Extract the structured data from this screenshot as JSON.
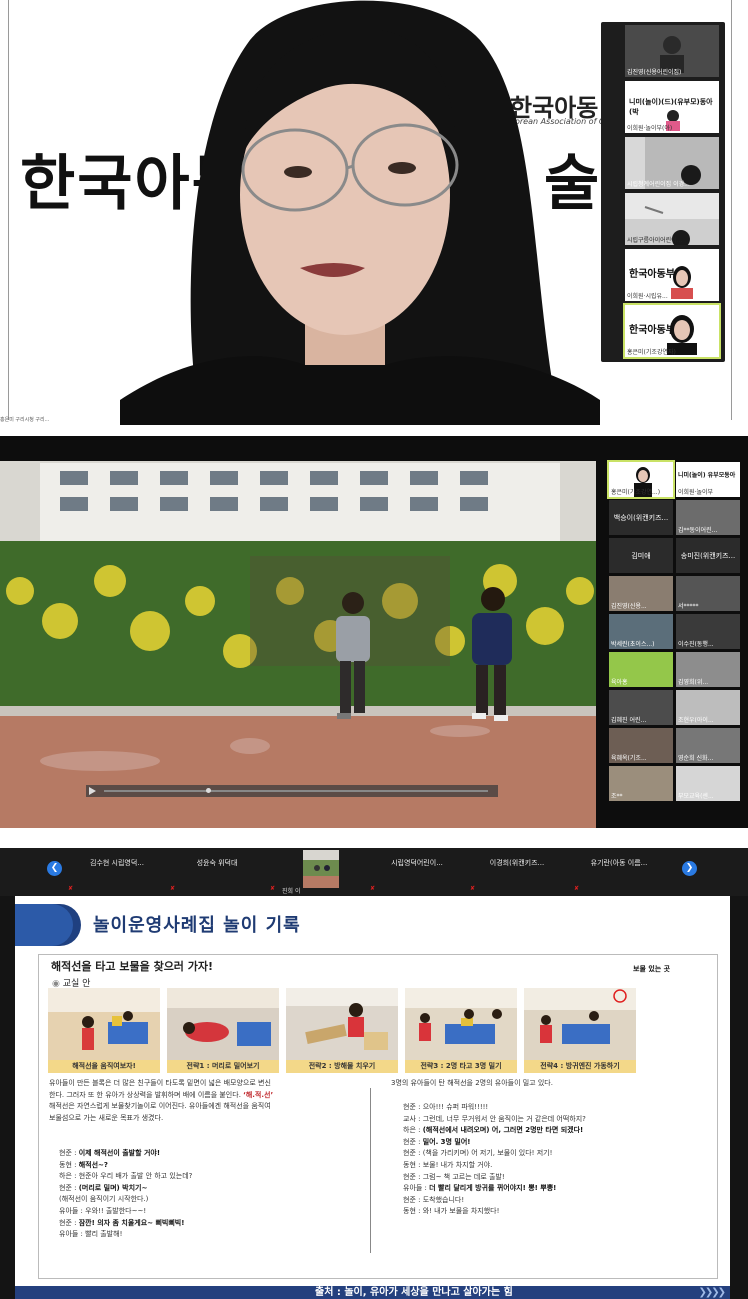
{
  "panel1": {
    "bg_logo_small": "한국아동",
    "bg_logo_english": "Korean Association of Chil",
    "bg_title": "한국아동부",
    "bg_title_right": "술세미",
    "tiny_label": "홍은미 구리시청 구리...",
    "participants": [
      {
        "label": "김진영(신용어린이집)"
      },
      {
        "label": "이희원·놀이부(아)",
        "logo_text": "니미(놀이)(드)(유부모)동아(박"
      },
      {
        "label": "시립청계어린이집 이경..."
      },
      {
        "label": "시립구름아이어린이..."
      },
      {
        "label": "이희원·시립유...",
        "logo_text": "한국아동부"
      },
      {
        "label": "홍은미(기조강연자)",
        "logo_text": "한국아동부"
      }
    ]
  },
  "panel2": {
    "participants": [
      {
        "name": "홍은미(기조강연...)"
      },
      {
        "name": "이희원·놀이부",
        "logo": "니미(놀이) 유부모동아"
      },
      {
        "name": "백승이(위캔키즈..."
      },
      {
        "name": "김**동이어린..."
      },
      {
        "name": "김미애"
      },
      {
        "name": "송미진(위캔키즈..."
      },
      {
        "name": "김진영(신용..."
      },
      {
        "name": "서*****"
      },
      {
        "name": "박세린(초이스...)"
      },
      {
        "name": "이수진(동행..."
      },
      {
        "name": "육아홍"
      },
      {
        "name": "김영희(위..."
      },
      {
        "name": "김혜진 어린..."
      },
      {
        "name": "조현우(아이..."
      },
      {
        "name": "육혜옥(기조..."
      },
      {
        "name": "영순희 신화..."
      },
      {
        "name": "조**"
      },
      {
        "name": "부모교육(센..."
      }
    ]
  },
  "panel3": {
    "thumbs": [
      "김수현 시립영덕...",
      "성윤숙 위덕대",
      "진희 이",
      "시립영덕어린이...",
      "이경희(위캔키즈...",
      "유기란(아동 이름..."
    ],
    "slide_title": "놀이운영사례집 놀이 기록",
    "subtitle": "해적선을 타고 보물을 찾으러 가자!",
    "location": "교실 안",
    "treasure_label": "보물 있는 곳",
    "captions": [
      "해적선을 움직여보자!",
      "전략1 : 머리로 밀어보기",
      "전략2 : 방해물 치우기",
      "전략3 : 2명 타고 3명 밀기",
      "전략4 : 방귀엔진 가동하기"
    ],
    "left_para": [
      "유아들이 만든 블록은 더 많은 친구들이 타도록 밑면이 넓은 배모양으로 변신",
      "한다. 그러자 또 한 유아가 상상력을 발휘하며 배에 이름을 붙인다.",
      "‘해.적.선’",
      "해적선은 자연스럽게 보물찾기놀이로 이어진다. 유아들에겐 해적선을 움직여",
      "보물섬으로 가는 새로운 목표가 생겼다."
    ],
    "left_dialog": [
      [
        "현준",
        "이제 해적선이 출발할 거야!"
      ],
      [
        "동현",
        "해적선~?"
      ],
      [
        "하은",
        "현준아 우리 배가 출발 안 하고 있는데?"
      ],
      [
        "현준",
        "(머리로 밀며) 박치기~"
      ],
      [
        "",
        "(해적선이 움직이기 시작한다.)"
      ],
      [
        "유아들",
        "우와!! 출발한다~~!"
      ],
      [
        "현준",
        "잠깐! 의자 좀 치울게요~ 삐빅삐빅!"
      ],
      [
        "유아들",
        "빨리 출발해!"
      ]
    ],
    "right_intro": "3명의 유아들이 탄 해적선을 2명의 유아들이 밀고 있다.",
    "right_dialog": [
      [
        "현준",
        "으아!!! 슈퍼 파워!!!!!"
      ],
      [
        "교사",
        "그런데, 너무 무거워서 안 움직이는 거 같은데 어떡하지?"
      ],
      [
        "하은",
        "(해적선에서 내려오며) 어, 그러면 2명만 타면 되겠다!"
      ],
      [
        "현준",
        "밀어. 3명 밀어!"
      ],
      [
        "현준",
        "(책을 가리키며) 어 저기, 보물이 있다! 저기!"
      ],
      [
        "동현",
        "보물! 내가 차지할 거야."
      ],
      [
        "현준",
        "그럼~ 책 고르는 데로 출발!"
      ],
      [
        "유아들",
        "더 빨리 달리게 방귀를 뀌어야지! 뽕! 뿌뿡!"
      ],
      [
        "현준",
        "도착했습니다!"
      ],
      [
        "동현",
        "와! 내가 보물을 차지했다!"
      ]
    ],
    "footer": "출처 : 놀이, 유아가 세상을 만나고 살아가는 힘"
  }
}
